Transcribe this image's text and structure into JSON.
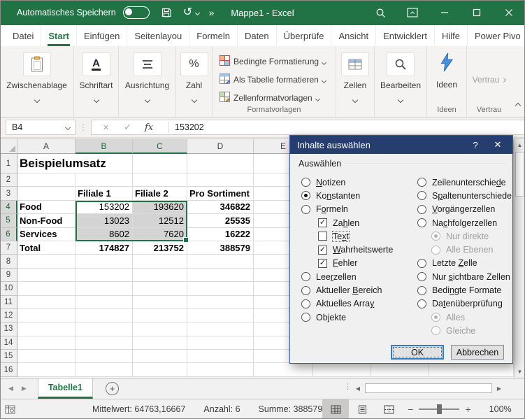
{
  "colors": {
    "excel_green": "#217346",
    "dialog_title_bg": "#263E6E",
    "selection_border": "#217346",
    "selection_fill": "#D4D4D4"
  },
  "title_bar": {
    "autosave": "Automatisches Speichern",
    "more": "»",
    "title": "Mappe1 - Excel"
  },
  "ribbon": {
    "tabs": [
      "Datei",
      "Start",
      "Einfügen",
      "Seitenlayou",
      "Formeln",
      "Daten",
      "Überprüfe",
      "Ansicht",
      "Entwicklert",
      "Hilfe",
      "Power Pivo"
    ],
    "active_tab": "Start",
    "collapsed_groups": [
      {
        "label": "Zwischenablage"
      },
      {
        "label": "Schriftart"
      },
      {
        "label": "Ausrichtung"
      },
      {
        "label": "Zahl"
      }
    ],
    "styles_buttons": [
      "Bedingte Formatierung",
      "Als Tabelle formatieren",
      "Zellenformatvorlagen"
    ],
    "styles_caption": "Formatvorlagen",
    "cells_label": "Zellen",
    "edit_label": "Bearbeiten",
    "ideas_label": "Ideen",
    "ideas_caption": "Ideen",
    "trust_label": "Vertrau",
    "trust_caption": "Vertrau"
  },
  "formula_bar": {
    "name_box": "B4",
    "fx": "fx",
    "value": "153202"
  },
  "sheet": {
    "columns": [
      "A",
      "B",
      "C",
      "D",
      "E"
    ],
    "row_count": 16,
    "selected_columns": [
      "B",
      "C"
    ],
    "selected_rows": [
      4,
      5,
      6
    ],
    "selection": {
      "cells": [
        "B4",
        "C4",
        "B5",
        "C5",
        "B6",
        "C6"
      ],
      "active": "B4"
    },
    "cells": [
      {
        "ref": "A1",
        "text": "Beispielumsatz",
        "style": "title"
      },
      {
        "ref": "B3",
        "text": "Filiale 1",
        "style": "bold"
      },
      {
        "ref": "C3",
        "text": "Filiale 2",
        "style": "bold"
      },
      {
        "ref": "D3",
        "text": "Pro Sortiment",
        "style": "bold"
      },
      {
        "ref": "A4",
        "text": "Food",
        "style": "bold"
      },
      {
        "ref": "B4",
        "text": "153202",
        "style": "num"
      },
      {
        "ref": "C4",
        "text": "193620",
        "style": "num"
      },
      {
        "ref": "D4",
        "text": "346822",
        "style": "numbold"
      },
      {
        "ref": "A5",
        "text": "Non-Food",
        "style": "bold"
      },
      {
        "ref": "B5",
        "text": "13023",
        "style": "num"
      },
      {
        "ref": "C5",
        "text": "12512",
        "style": "num"
      },
      {
        "ref": "D5",
        "text": "25535",
        "style": "numbold"
      },
      {
        "ref": "A6",
        "text": "Services",
        "style": "bold"
      },
      {
        "ref": "B6",
        "text": "8602",
        "style": "num"
      },
      {
        "ref": "C6",
        "text": "7620",
        "style": "num"
      },
      {
        "ref": "D6",
        "text": "16222",
        "style": "numbold"
      },
      {
        "ref": "A7",
        "text": "Total",
        "style": "bold"
      },
      {
        "ref": "B7",
        "text": "174827",
        "style": "numbold"
      },
      {
        "ref": "C7",
        "text": "213752",
        "style": "numbold"
      },
      {
        "ref": "D7",
        "text": "388579",
        "style": "numbold"
      }
    ]
  },
  "dialog": {
    "title": "Inhalte auswählen",
    "help": "?",
    "close": "✕",
    "group_label": "Auswählen",
    "left_options": [
      {
        "label": "[N]otizen",
        "type": "radio",
        "state": "off"
      },
      {
        "label": "Ko[n]stanten",
        "type": "radio",
        "state": "on"
      },
      {
        "label": "F[o]rmeln",
        "type": "radio",
        "state": "off"
      },
      {
        "label": "Za[h]len",
        "type": "checkbox",
        "state": "checked",
        "indent": true
      },
      {
        "label": "Te[x]t",
        "type": "checkbox",
        "state": "unchecked",
        "indent": true,
        "focused": true
      },
      {
        "label": "[W]ahrheitswerte",
        "type": "checkbox",
        "state": "checked",
        "indent": true
      },
      {
        "label": "[F]ehler",
        "type": "checkbox",
        "state": "checked",
        "indent": true
      },
      {
        "label": "Lee[r]zellen",
        "type": "radio",
        "state": "off"
      },
      {
        "label": "Aktueller [B]ereich",
        "type": "radio",
        "state": "off"
      },
      {
        "label": "Aktuelles Arra[y]",
        "type": "radio",
        "state": "off"
      },
      {
        "label": "Ob[j]ekte",
        "type": "radio",
        "state": "off"
      }
    ],
    "right_options": [
      {
        "label": "Zeilenunterschie[d]e",
        "type": "radio",
        "state": "off"
      },
      {
        "label": "S[p]altenunterschiede",
        "type": "radio",
        "state": "off"
      },
      {
        "label": "[V]orgängerzellen",
        "type": "radio",
        "state": "off"
      },
      {
        "label": "Na[c]hfolgerzellen",
        "type": "radio",
        "state": "off"
      },
      {
        "label": "Nur direkte",
        "type": "radio",
        "state": "on",
        "disabled": true,
        "indent": true
      },
      {
        "label": "Alle Ebenen",
        "type": "radio",
        "state": "off",
        "disabled": true,
        "indent": true
      },
      {
        "label": "Letzte [Z]elle",
        "type": "radio",
        "state": "off"
      },
      {
        "label": "Nur [s]ichtbare Zellen",
        "type": "radio",
        "state": "off"
      },
      {
        "label": "Bedi[n]gte Formate",
        "type": "radio",
        "state": "off"
      },
      {
        "label": "Da[t]enüberprüfung",
        "type": "radio",
        "state": "off"
      },
      {
        "label": "Alles",
        "type": "radio",
        "state": "on",
        "disabled": true,
        "indent": true
      },
      {
        "label": "Gleiche",
        "type": "radio",
        "state": "off",
        "disabled": true,
        "indent": true
      }
    ],
    "ok": "OK",
    "cancel": "Abbrechen"
  },
  "sheet_tabs": {
    "active": "Tabelle1",
    "add": "+"
  },
  "status_bar": {
    "stats": [
      "Mittelwert: 64763,16667",
      "Anzahl: 6",
      "Summe: 388579"
    ],
    "zoom": "100%"
  }
}
